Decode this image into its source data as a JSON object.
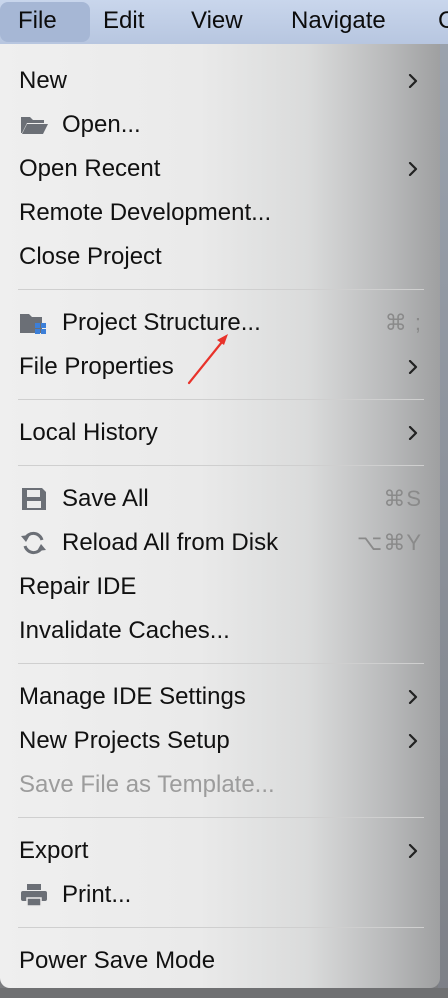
{
  "menubar": {
    "items": [
      "File",
      "Edit",
      "View",
      "Navigate",
      "C"
    ],
    "active": "File"
  },
  "menu": {
    "new": {
      "label": "New"
    },
    "open": {
      "label": "Open...",
      "icon": "folder-icon"
    },
    "open_recent": {
      "label": "Open Recent"
    },
    "remote_dev": {
      "label": "Remote Development..."
    },
    "close_project": {
      "label": "Close Project"
    },
    "project_structure": {
      "label": "Project Structure...",
      "shortcut": "⌘ ;",
      "icon": "project-structure-icon"
    },
    "file_properties": {
      "label": "File Properties"
    },
    "local_history": {
      "label": "Local History"
    },
    "save_all": {
      "label": "Save All",
      "shortcut": "⌘S",
      "icon": "save-icon"
    },
    "reload": {
      "label": "Reload All from Disk",
      "shortcut": "⌥⌘Y",
      "icon": "reload-icon"
    },
    "repair_ide": {
      "label": "Repair IDE"
    },
    "invalidate_caches": {
      "label": "Invalidate Caches..."
    },
    "manage_settings": {
      "label": "Manage IDE Settings"
    },
    "new_projects_setup": {
      "label": "New Projects Setup"
    },
    "save_template": {
      "label": "Save File as Template...",
      "disabled": true
    },
    "export": {
      "label": "Export"
    },
    "print": {
      "label": "Print...",
      "icon": "printer-icon"
    },
    "power_save": {
      "label": "Power Save Mode"
    }
  },
  "colors": {
    "menubar_bg": "#bfcde6",
    "menu_bg": "#ececec",
    "disabled_text": "#9c9c9c",
    "arrow_annotation": "#e8322a"
  }
}
